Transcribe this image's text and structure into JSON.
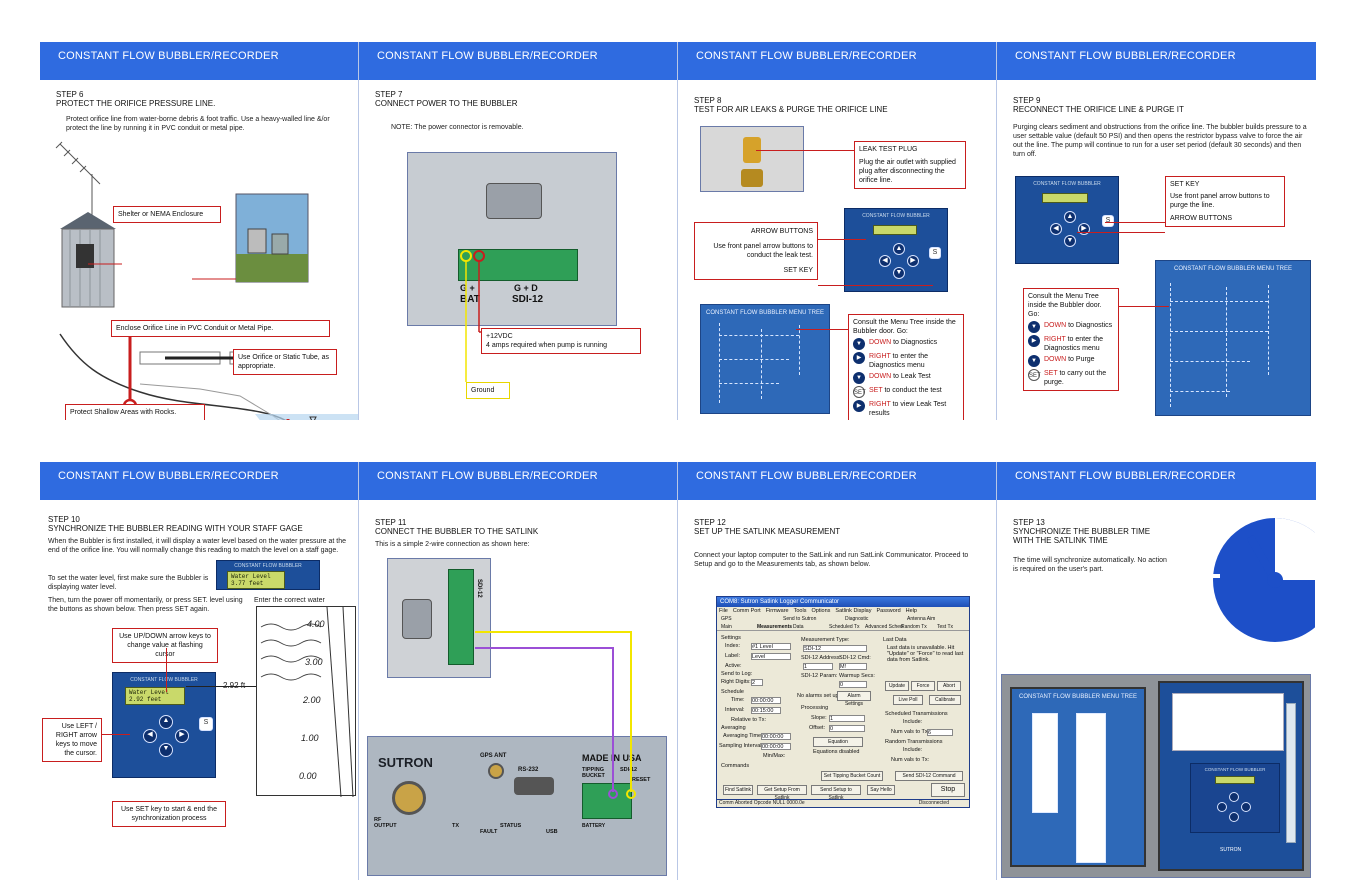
{
  "header": "CONSTANT FLOW BUBBLER/RECORDER",
  "step6": {
    "num": "STEP 6",
    "title": "PROTECT THE ORIFICE PRESSURE LINE.",
    "body": "Protect orifice line from water-borne debris & foot traffic. Use a heavy-walled line &/or protect the line by running it in PVC conduit or metal pipe.",
    "callouts": {
      "shelter": "Shelter or NEMA Enclosure",
      "enclose": "Enclose Orifice Line in PVC Conduit or Metal Pipe.",
      "orifice": "Use Orifice or Static Tube, as appropriate.",
      "rocks": "Protect Shallow Areas with Rocks."
    }
  },
  "step7": {
    "num": "STEP 7",
    "title": "CONNECT POWER TO THE BUBBLER",
    "note": "NOTE:  The power connector is removable.",
    "labels": {
      "g_plus": "G +",
      "bat": "BAT",
      "gd": "G + D",
      "sdi": "SDI-12"
    },
    "callouts": {
      "power": "+12VDC",
      "power2": "4 amps required when pump is running",
      "ground": "Ground"
    }
  },
  "step8": {
    "num": "STEP 8",
    "title": "TEST FOR AIR LEAKS & PURGE THE ORIFICE LINE",
    "leak_title": "LEAK TEST PLUG",
    "leak_body": "Plug the air outlet with supplied plug after disconnecting the orifice line.",
    "arrow_title": "ARROW BUTTONS",
    "arrow_body": "Use front panel arrow buttons to conduct the leak test.",
    "setkey": "SET KEY",
    "panel_label": "CONSTANT FLOW BUBBLER",
    "tree_title": "CONSTANT FLOW BUBBLER MENU TREE",
    "menu_intro": "Consult the Menu Tree inside the Bubbler door. Go:",
    "menu": [
      {
        "key": "DOWN",
        "rest": " to Diagnostics",
        "icon": "▼"
      },
      {
        "key": "RIGHT",
        "rest": " to enter the Diagnostics menu",
        "icon": "▶"
      },
      {
        "key": "DOWN",
        "rest": " to Leak Test",
        "icon": "▼"
      },
      {
        "key": "SET",
        "rest": " to conduct the test",
        "icon": "SET"
      },
      {
        "key": "RIGHT",
        "rest": " to view Leak Test results",
        "icon": "▶"
      }
    ]
  },
  "step9": {
    "num": "STEP 9",
    "title": "RECONNECT THE ORIFICE LINE & PURGE IT",
    "body": "Purging clears sediment and obstructions from the orifice line. The bubbler builds pressure to a user settable value (default 50 PSI) and then opens the restrictor bypass valve to force the air out the line. The pump will continue to run for a user set period (default 30 seconds) and then turn off.",
    "setkey_title": "SET KEY",
    "setkey_body": "Use front panel arrow buttons to purge the line.",
    "arrow": "ARROW BUTTONS",
    "panel_label": "CONSTANT FLOW BUBBLER",
    "tree_title": "CONSTANT FLOW BUBBLER MENU TREE",
    "menu_intro": "Consult the Menu Tree inside the Bubbler door.  Go:",
    "menu": [
      {
        "key": "DOWN",
        "rest": " to Diagnostics",
        "icon": "▼"
      },
      {
        "key": "RIGHT",
        "rest": " to enter the Diagnostics menu",
        "icon": "▶"
      },
      {
        "key": "DOWN",
        "rest": " to Purge",
        "icon": "▼"
      },
      {
        "key": "SET",
        "rest": " to carry out the purge.",
        "icon": "SET"
      }
    ]
  },
  "step10": {
    "num": "STEP 10",
    "title": "SYNCHRONIZE THE BUBBLER READING WITH YOUR STAFF GAGE",
    "p1": "When the Bubbler is first installed, it will display a water level based on the water pressure at the end of the orifice line. You will normally change this reading to match the level on a staff gage.",
    "p2": "To set the water level, first make sure the Bubbler is displaying water level.",
    "p3": "Then, turn the power off momentarily, or press SET. level using the buttons as shown below. Then press SET again.",
    "enter": "Enter the correct water",
    "lcd1": "Water Level",
    "lcd2": "3.77 feet",
    "lcd3": "Water Level",
    "lcd4": "2.92 feet",
    "panel_label": "CONSTANT FLOW BUBBLER",
    "updown": "Use UP/DOWN arrow keys to change value at flashing cursor",
    "leftright": "Use LEFT / RIGHT arrow keys to move the cursor.",
    "setkey": "Use SET key to start & end the synchronization process",
    "reading": "2.92 ft",
    "gage": [
      "4.00",
      "3.00",
      "2.00",
      "1.00",
      "0.00"
    ]
  },
  "step11": {
    "num": "STEP 11",
    "title": "CONNECT THE BUBBLER TO THE SATLINK",
    "body": "This is a simple 2-wire connection as shown here:",
    "labels": {
      "sutron": "SUTRON",
      "gps": "GPS ANT",
      "rs232": "RS-232",
      "made": "MADE IN USA",
      "tipping": "TIPPING BUCKET",
      "sdi": "SDI-12",
      "reset": "RESET",
      "rf": "RF OUTPUT",
      "tx": "TX",
      "status": "STATUS",
      "fault": "FAULT",
      "usb": "USB",
      "bat": "BATTERY"
    }
  },
  "step12": {
    "num": "STEP 12",
    "title": "SET UP THE SATLINK MEASUREMENT",
    "body": "Connect your laptop computer to the SatLink and run SatLink Communicator.  Proceed to Setup and go to the Measurements tab, as shown below.",
    "window_title": "COM8: Sutron Satlink Logger Communicator",
    "menu": [
      "File",
      "Comm Port",
      "Firmware",
      "Tools",
      "Options",
      "Satlink Display",
      "Password",
      "Help"
    ],
    "tabs": [
      "GPS",
      "Send to Sutron",
      "Diagnostic",
      "Antenna Aim",
      "Main",
      "Measurements",
      "Data",
      "Scheduled Tx",
      "Advanced Sched",
      "Random Tx",
      "Test Tx"
    ],
    "fields": {
      "index": "#1 Level",
      "label": "Level",
      "mtype": "SDI-12",
      "rdigits": "2",
      "time": "00:00:00",
      "interval": "00:15:00",
      "avgtime": "00:00:00",
      "sampint": "00:00:00",
      "slope": "1",
      "offset": "0",
      "sdiaddr": "1",
      "sdicmd": "M!",
      "warmup": "0",
      "numvals": "6"
    },
    "labels": {
      "settings": "Settings",
      "index": "Index:",
      "label": "Label:",
      "active": "Active:",
      "sendlog": "Send to Log:",
      "rdig": "Right Digits:",
      "schedule": "Schedule",
      "time": "Time:",
      "interval": "Interval:",
      "relative": "Relative to Tx:",
      "averaging": "Averaging",
      "avgtime": "Averaging Time:",
      "sampint": "Sampling Interval:",
      "minmax": "Min/Max:",
      "mtype": "Measurement Type:",
      "sdiaddr": "SDI-12 Address:",
      "sdicmd": "SDI-12 Cmd:",
      "sdiparam": "SDI-12 Param:",
      "warmup": "Warmup Secs:",
      "noalarm": "No alarms set up",
      "alarmset": "Alarm Settings",
      "processing": "Processing",
      "slope": "Slope:",
      "offset": "Offset:",
      "equation": "Equation",
      "eqdis": "Equations disabled",
      "lastdata": "Last Data",
      "lastdata_body": "Last data is unavailable. Hit \"Update\" or \"Force\" to read last data from Satlink.",
      "update": "Update",
      "force": "Force",
      "abort": "Abort",
      "livepoll": "Live Poll",
      "calibrate": "Calibrate",
      "schedtx": "Scheduled Transmissions",
      "include": "Include:",
      "numvals": "Num vals to Tx:",
      "randtx": "Random Transmissions",
      "include2": "Include:",
      "numvals2": "Num vals to Tx:",
      "commands": "Commands",
      "settip": "Set Tipping Bucket Count",
      "sendsdi": "Send SDI-12 Command",
      "find": "Find Satlink",
      "get": "Get Setup From Satlink",
      "send": "Send Setup to Satlink",
      "sayhello": "Say Hello",
      "stop": "Stop",
      "status": "Comm Aborted  Opcode NULL  0000.0e",
      "disconnected": "Disconnected"
    }
  },
  "step13": {
    "num": "STEP 13",
    "title": "SYNCHRONIZE THE BUBBLER TIME WITH THE SATLINK TIME",
    "body": "The time will synchronize automatically. No action is required on the user's part.",
    "tree_title": "CONSTANT FLOW BUBBLER MENU TREE",
    "panel_label": "CONSTANT FLOW BUBBLER",
    "logo": "SUTRON"
  },
  "colors": {
    "header": "#2f6be0",
    "callout": "#c81e1e",
    "device": "#1d4f9a",
    "lcd": "#c9d96a",
    "wire_yellow": "#f2e600",
    "wire_purple": "#9b4fd6"
  }
}
